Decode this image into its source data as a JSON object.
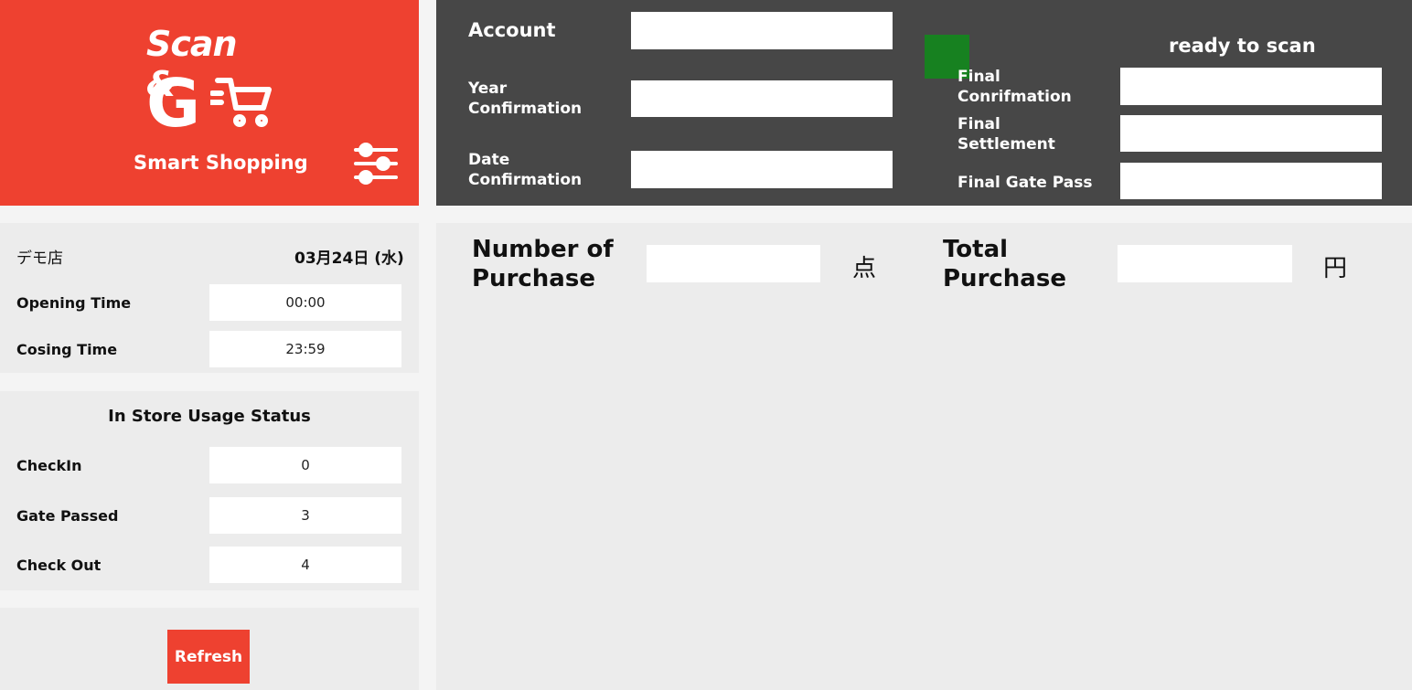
{
  "brand": {
    "logo_line1": "Scan &",
    "logo_g": "G",
    "tagline": "Smart Shopping",
    "color": "#ee4130"
  },
  "top": {
    "account_label": "Account",
    "year_label": "Year Confirmation",
    "date_label": "Date Confirmation",
    "status_text": "ready to scan",
    "status_color": "#178120",
    "final_confirmation_label": "Final Conrifmation",
    "final_settlement_label": "Final Settlement",
    "final_gate_pass_label": "Final Gate Pass",
    "account_value": "",
    "year_value": "",
    "date_value": "",
    "final_confirmation_value": "",
    "final_settlement_value": "",
    "final_gate_pass_value": ""
  },
  "store": {
    "name": "デモ店",
    "date": "03月24日 (水)",
    "opening_label": "Opening Time",
    "opening_value": "00:00",
    "closing_label": "Cosing Time",
    "closing_value": "23:59"
  },
  "usage": {
    "title": "In Store Usage Status",
    "checkin_label": "CheckIn",
    "checkin_value": "0",
    "gate_label": "Gate Passed",
    "gate_value": "3",
    "checkout_label": "Check Out",
    "checkout_value": "4"
  },
  "refresh_label": "Refresh",
  "main": {
    "num_label_1": "Number of",
    "num_label_2": "Purchase",
    "num_value": "",
    "num_unit": "点",
    "total_label_1": "Total",
    "total_label_2": "Purchase",
    "total_value": "",
    "total_unit": "円"
  },
  "icons": {
    "logo": "shopping-cart-icon",
    "settings": "sliders-icon"
  }
}
